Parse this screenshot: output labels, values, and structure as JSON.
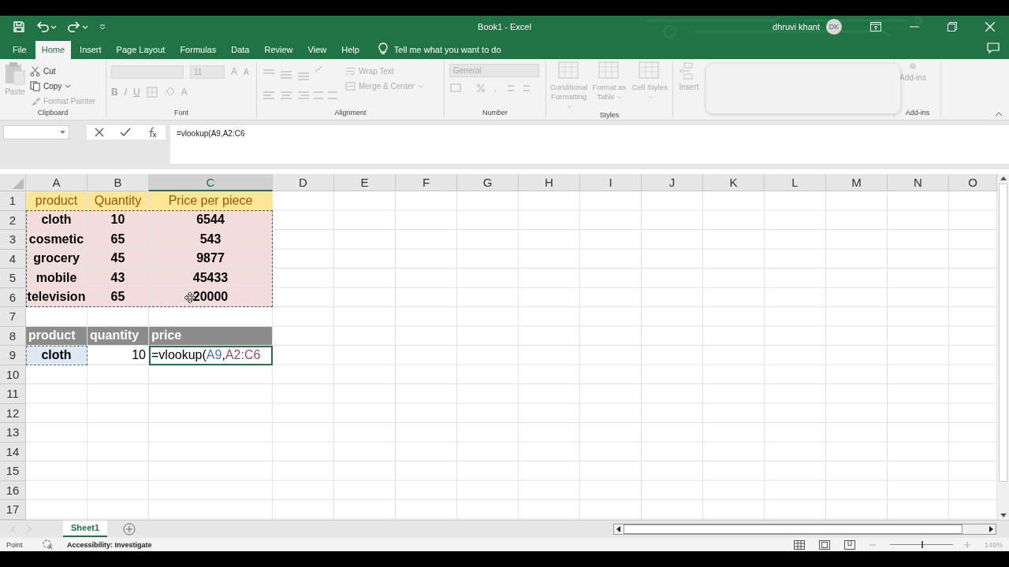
{
  "window": {
    "title": "Book1  -  Excel",
    "user": "dhruvi khant",
    "avatar": "DK"
  },
  "menu_tabs": [
    {
      "label": "File",
      "selected": false
    },
    {
      "label": "Home",
      "selected": true
    },
    {
      "label": "Insert",
      "selected": false
    },
    {
      "label": "Page Layout",
      "selected": false
    },
    {
      "label": "Formulas",
      "selected": false
    },
    {
      "label": "Data",
      "selected": false
    },
    {
      "label": "Review",
      "selected": false
    },
    {
      "label": "View",
      "selected": false
    },
    {
      "label": "Help",
      "selected": false
    }
  ],
  "tell_me": "Tell me what you want to do",
  "ribbon": {
    "clipboard": {
      "label": "Clipboard",
      "paste": {
        "label": "Paste",
        "disabled": true
      },
      "cut": {
        "label": "Cut",
        "disabled": false
      },
      "copy": {
        "label": "Copy",
        "disabled": false
      },
      "format_painter": {
        "label": "Format Painter",
        "disabled": true
      }
    },
    "font": {
      "label": "Font",
      "size": "11",
      "grow": "A",
      "shrink": "A",
      "bold": "B",
      "italic": "I",
      "underline": "U",
      "font_color": "A"
    },
    "alignment": {
      "label": "Alignment",
      "wrap_text": {
        "label": "Wrap Text",
        "disabled": true
      },
      "merge_center": {
        "label": "Merge & Center",
        "disabled": true
      }
    },
    "number": {
      "label": "Number",
      "format": "General"
    },
    "styles": {
      "label": "Styles",
      "buttons": [
        {
          "label": "Conditional Formatting",
          "disabled": true
        },
        {
          "label": "Format as Table",
          "disabled": true
        },
        {
          "label": "Cell Styles",
          "disabled": true
        }
      ]
    },
    "cells": {
      "insert": {
        "label": "Insert",
        "disabled": true
      }
    },
    "addins": {
      "label": "Add-ins",
      "button": {
        "label": "Add-ins",
        "disabled": true
      }
    }
  },
  "formula_bar": {
    "formula": "=vlookup(A9,A2:C6"
  },
  "columns": [
    {
      "label": "A",
      "selected": false
    },
    {
      "label": "B",
      "selected": false
    },
    {
      "label": "C",
      "selected": true
    },
    {
      "label": "D",
      "selected": false
    },
    {
      "label": "E",
      "selected": false
    },
    {
      "label": "F",
      "selected": false
    },
    {
      "label": "G",
      "selected": false
    },
    {
      "label": "H",
      "selected": false
    },
    {
      "label": "I",
      "selected": false
    },
    {
      "label": "J",
      "selected": false
    },
    {
      "label": "K",
      "selected": false
    },
    {
      "label": "L",
      "selected": false
    },
    {
      "label": "M",
      "selected": false
    },
    {
      "label": "N",
      "selected": false
    },
    {
      "label": "O",
      "selected": false
    }
  ],
  "rows": [
    {
      "number": "1",
      "cells": [
        {
          "kind": "header",
          "text": "product"
        },
        {
          "kind": "header",
          "text": "Quantity"
        },
        {
          "kind": "header",
          "text": "Price per piece"
        }
      ]
    },
    {
      "number": "2",
      "cells": [
        {
          "kind": "data",
          "text": "cloth"
        },
        {
          "kind": "data",
          "text": "10"
        },
        {
          "kind": "data",
          "text": "6544"
        }
      ]
    },
    {
      "number": "3",
      "cells": [
        {
          "kind": "data",
          "text": "cosmetic"
        },
        {
          "kind": "data",
          "text": "65"
        },
        {
          "kind": "data",
          "text": "543"
        }
      ]
    },
    {
      "number": "4",
      "cells": [
        {
          "kind": "data",
          "text": "grocery"
        },
        {
          "kind": "data",
          "text": "45"
        },
        {
          "kind": "data",
          "text": "9877"
        }
      ]
    },
    {
      "number": "5",
      "cells": [
        {
          "kind": "data",
          "text": "mobile"
        },
        {
          "kind": "data",
          "text": "43"
        },
        {
          "kind": "data",
          "text": "45433"
        }
      ]
    },
    {
      "number": "6",
      "cells": [
        {
          "kind": "data",
          "text": "television"
        },
        {
          "kind": "data",
          "text": "65"
        },
        {
          "kind": "data",
          "text": "20000",
          "pointer": true
        }
      ]
    },
    {
      "number": "7",
      "cells": []
    },
    {
      "number": "8",
      "cells": [
        {
          "kind": "label",
          "text": "product"
        },
        {
          "kind": "label",
          "text": "quantity"
        },
        {
          "kind": "label",
          "text": "price"
        }
      ]
    },
    {
      "number": "9",
      "cells": [
        {
          "kind": "data",
          "text": "cloth",
          "marked": true
        },
        {
          "kind": "number",
          "text": "10"
        },
        {
          "kind": "formula",
          "active": true,
          "segments": [
            {
              "text": "=vlookup("
            },
            {
              "text": "A9",
              "color": "#4472c4"
            },
            {
              "text": ","
            },
            {
              "text": "A2:C6",
              "color": "#a5445c"
            }
          ]
        }
      ]
    },
    {
      "number": "10",
      "cells": []
    },
    {
      "number": "11",
      "cells": []
    },
    {
      "number": "12",
      "cells": []
    },
    {
      "number": "13",
      "cells": []
    },
    {
      "number": "14",
      "cells": []
    },
    {
      "number": "15",
      "cells": []
    },
    {
      "number": "16",
      "cells": []
    },
    {
      "number": "17",
      "cells": []
    }
  ],
  "sheet_tabs": [
    {
      "label": "Sheet1",
      "selected": true
    }
  ],
  "status_bar": {
    "mode": "Point",
    "accessibility": "Accessibility: Investigate",
    "zoom": "146%",
    "zoom_level": {
      "level": 0.5
    }
  }
}
